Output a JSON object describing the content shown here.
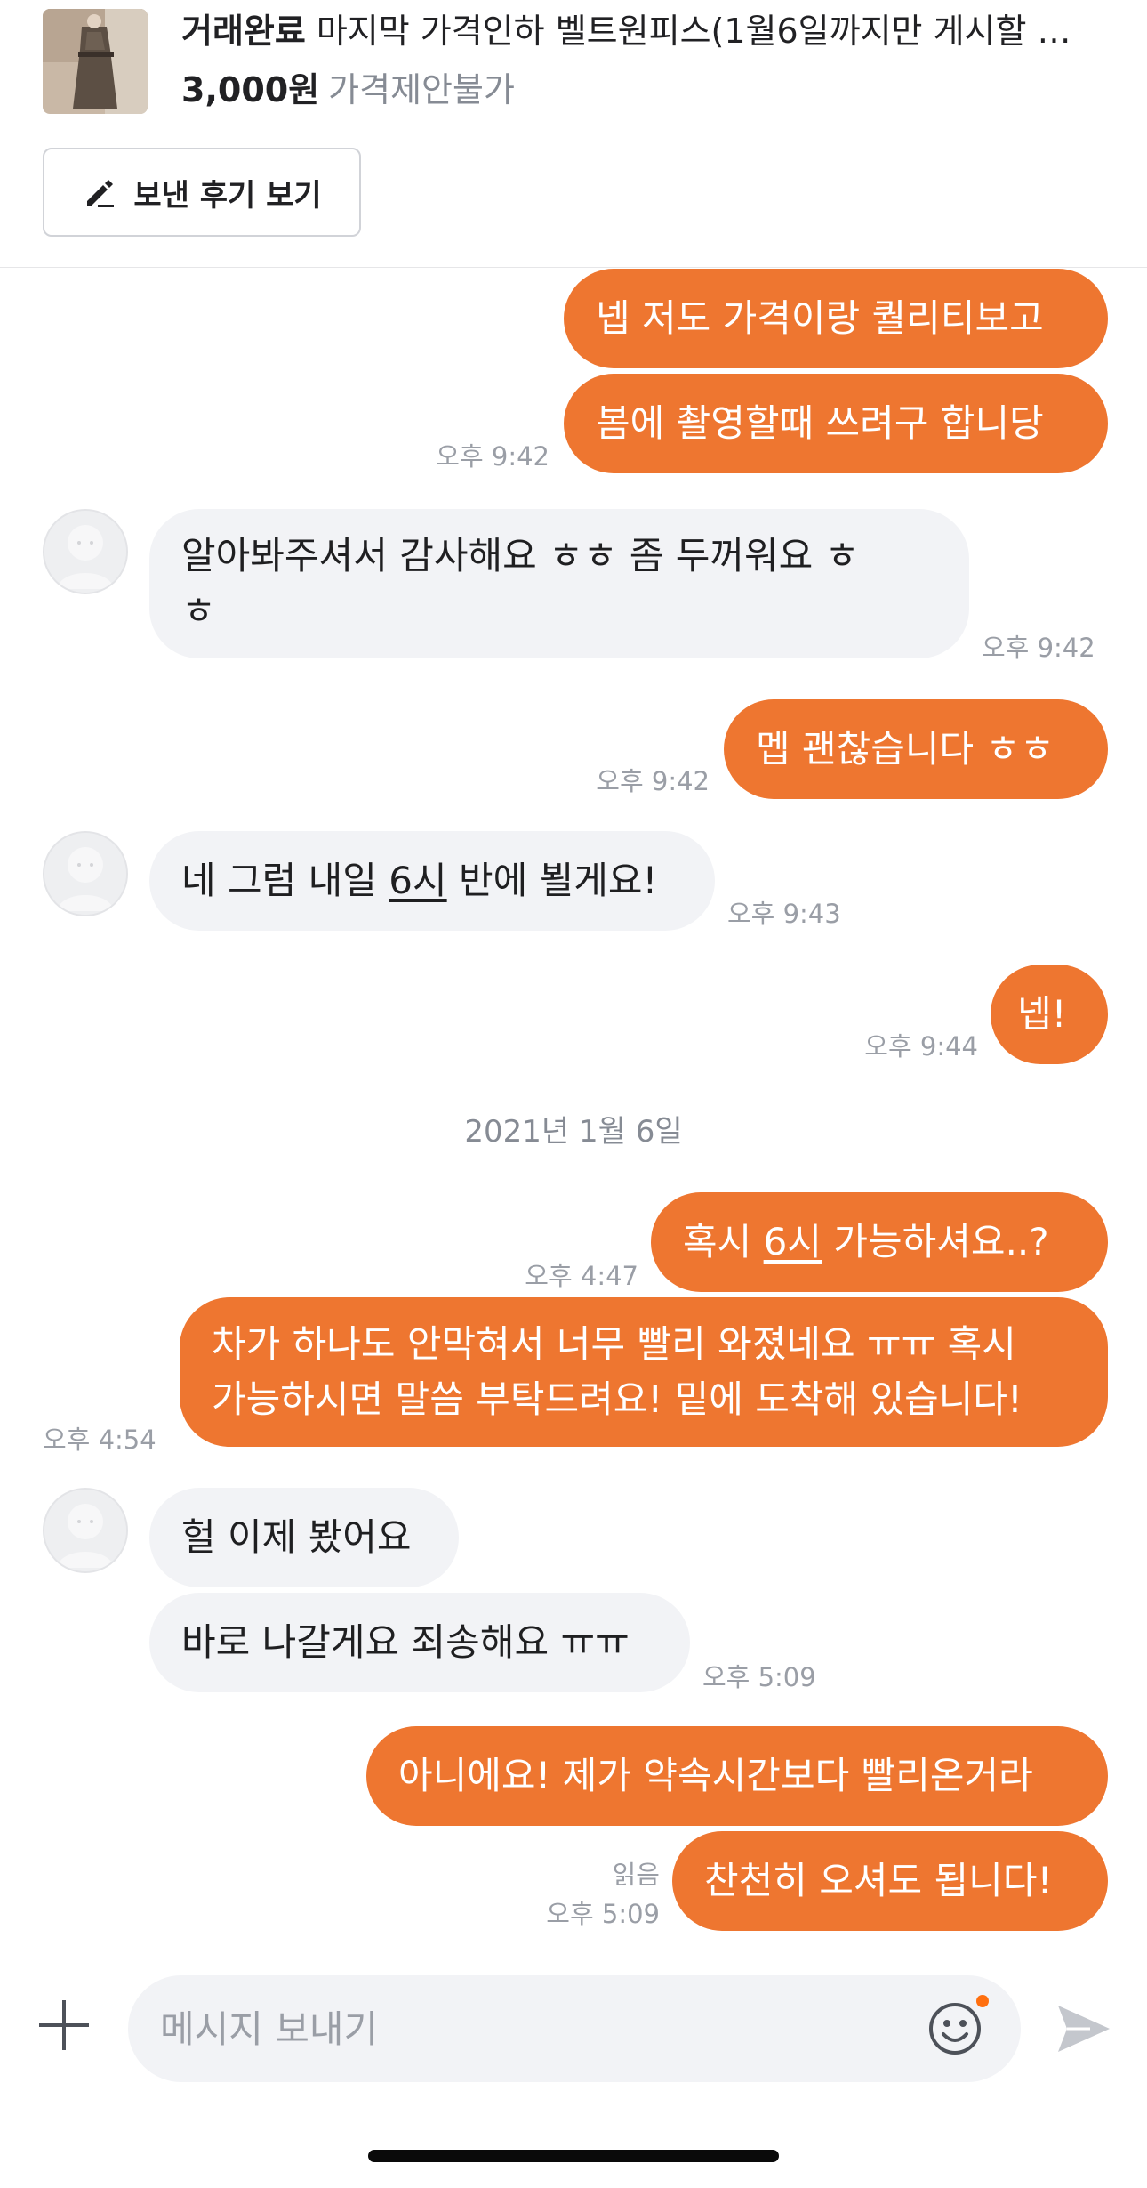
{
  "product": {
    "status": "거래완료",
    "title": "마지막 가격인하 벨트원피스(1월6일까지만 게시할 …",
    "price": "3,000원",
    "negotiation": "가격제안불가",
    "review_button": "보낸 후기 보기",
    "review_icon": "pencil-icon"
  },
  "messages": {
    "m1": {
      "text": "넵 저도 가격이랑 퀄리티보고"
    },
    "m2": {
      "text": "봄에 촬영할때 쓰려구 합니당",
      "time": "오후 9:42"
    },
    "m3": {
      "line1": "알아봐주셔서 감사해요 ㅎㅎ 좀 두꺼워요 ㅎ",
      "line2": "ㅎ",
      "time": "오후 9:42"
    },
    "m4": {
      "text": "멥 괜찮습니다 ㅎㅎ",
      "time": "오후 9:42"
    },
    "m5": {
      "pre": "네 그럼 내일 ",
      "link": "6시",
      "post": " 반에 뵐게요!",
      "time": "오후 9:43"
    },
    "m6": {
      "text": "넵!",
      "time": "오후 9:44"
    },
    "date_separator": "2021년 1월 6일",
    "m7": {
      "pre": "혹시 ",
      "link": "6시",
      "post": " 가능하셔요..?",
      "time": "오후 4:47"
    },
    "m8": {
      "line1": "차가 하나도 안막혀서 너무 빨리 와졌네요 ㅠㅠ 혹시",
      "line2": "가능하시면 말씀 부탁드려요! 밑에 도착해 있습니다!",
      "time": "오후 4:54"
    },
    "m9": {
      "text": "헐 이제 봤어요"
    },
    "m10": {
      "text": "바로 나갈게요 죄송해요 ㅠㅠ",
      "time": "오후 5:09"
    },
    "m11": {
      "text": "아니에요! 제가 약속시간보다 빨리온거라"
    },
    "m12": {
      "text": "찬천히 오셔도 됩니다!",
      "read": "읽음",
      "time": "오후 5:09"
    }
  },
  "composer": {
    "placeholder": "메시지 보내기",
    "icons": [
      "plus-icon",
      "emoji-icon",
      "send-icon"
    ]
  },
  "colors": {
    "outgoing_bubble": "#ee7630",
    "incoming_bubble": "#f2f3f6",
    "timestamp": "#9a9ea6"
  }
}
